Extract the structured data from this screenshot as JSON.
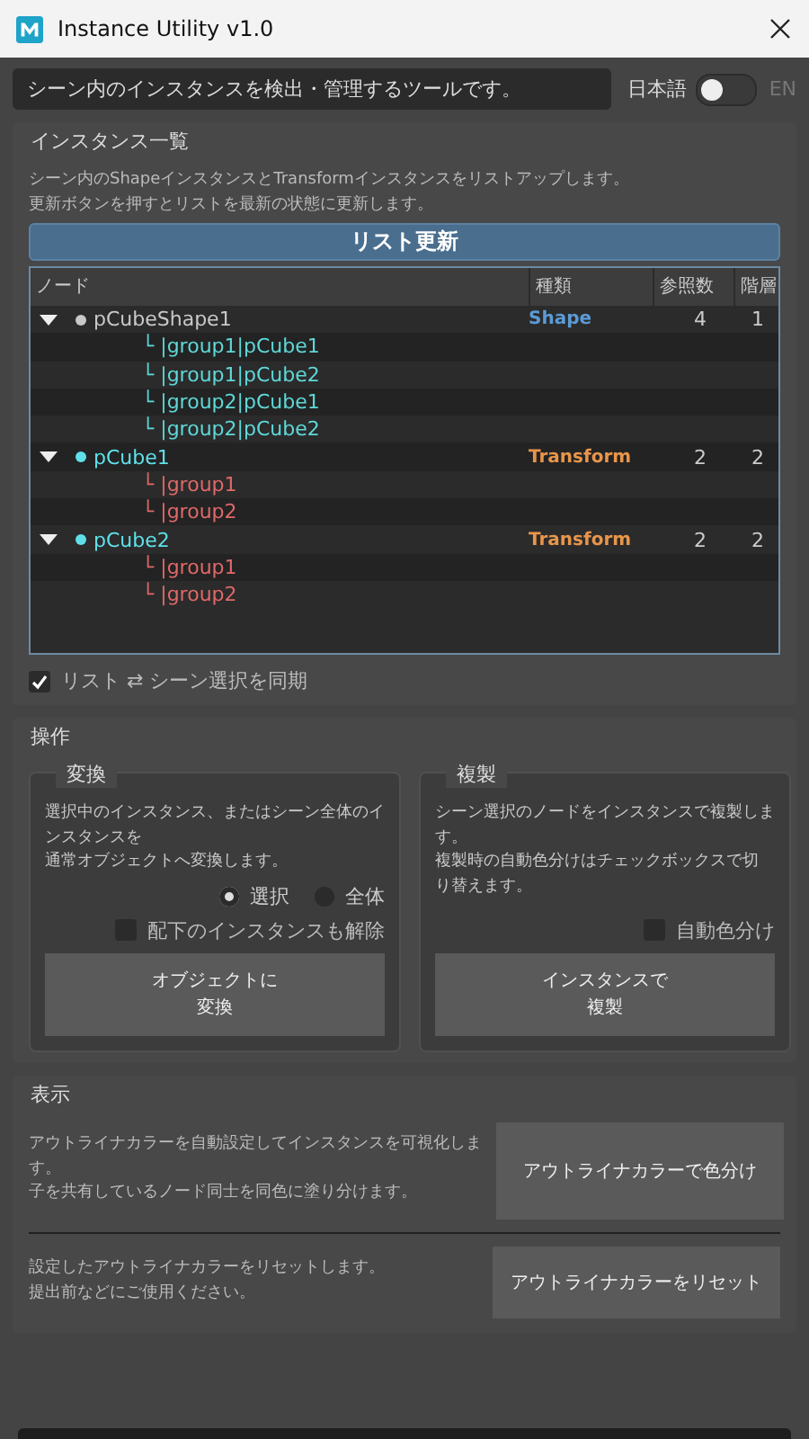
{
  "window": {
    "title": "Instance Utility v1.0"
  },
  "header": {
    "description": "シーン内のインスタンスを検出・管理するツールです。",
    "language": {
      "left": "日本語",
      "right": "EN",
      "on": false
    }
  },
  "instances": {
    "title": "インスタンス一覧",
    "description": [
      "シーン内のShapeインスタンスとTransformインスタンスをリストアップします。",
      "更新ボタンを押すとリストを最新の状態に更新します。"
    ],
    "refresh_button": "リスト更新",
    "table": {
      "columns": [
        "ノード",
        "種類",
        "参照数",
        "階層"
      ],
      "rows": [
        {
          "name": "pCubeShape1",
          "expanded": true,
          "color": "#c8c8c8",
          "type": "Shape",
          "kind": "shape",
          "count": "4",
          "level_text": "1",
          "children": [
            {
              "path": "└ |group1|pCube1",
              "color": "#5fd8d8"
            },
            {
              "path": "└ |group1|pCube2",
              "color": "#5fd8d8"
            },
            {
              "path": "└ |group2|pCube1",
              "color": "#5fd8d8"
            },
            {
              "path": "└ |group2|pCube2",
              "color": "#5fd8d8"
            }
          ]
        },
        {
          "name": "pCube1",
          "expanded": true,
          "color": "#5fe0e8",
          "type": "Transform",
          "kind": "transform",
          "count": "2",
          "level_text": "2",
          "children": [
            {
              "path": "└ |group1",
              "color": "#e06868"
            },
            {
              "path": "└ |group2",
              "color": "#e06868"
            }
          ]
        },
        {
          "name": "pCube2",
          "expanded": true,
          "color": "#5fe0e8",
          "type": "Transform",
          "kind": "transform",
          "count": "2",
          "level_text": "2",
          "children": [
            {
              "path": "└ |group1",
              "color": "#e06868"
            },
            {
              "path": "└ |group2",
              "color": "#e06868"
            }
          ]
        }
      ]
    },
    "sync": {
      "label": "リスト ⇄ シーン選択を同期",
      "checked": true
    }
  },
  "operations": {
    "title": "操作",
    "convert": {
      "title": "変換",
      "description": [
        "選択中のインスタンス、またはシーン全体のイ",
        "ンスタンスを",
        "通常オブジェクトへ変換します。"
      ],
      "radios": [
        {
          "label": "選択",
          "selected": true
        },
        {
          "label": "全体",
          "selected": false
        }
      ],
      "checkbox": {
        "label": "配下のインスタンスも解除",
        "checked": false
      },
      "button": [
        "オブジェクトに",
        "変換"
      ]
    },
    "duplicate": {
      "title": "複製",
      "description": [
        "シーン選択のノードをインスタンスで複製しま",
        "す。",
        "複製時の自動色分けはチェックボックスで切",
        "り替えます。"
      ],
      "checkbox": {
        "label": "自動色分け",
        "checked": false
      },
      "button": [
        "インスタンスで",
        "複製"
      ]
    }
  },
  "display": {
    "title": "表示",
    "items": [
      {
        "description": [
          "アウトライナカラーを自動設定してインスタンスを可視化しま",
          "す。",
          "子を共有しているノード同士を同色に塗り分けます。"
        ],
        "button": "アウトライナカラーで色分け"
      },
      {
        "description": [
          "設定したアウトライナカラーをリセットします。",
          "提出前などにご使用ください。"
        ],
        "button": "アウトライナカラーをリセット"
      }
    ]
  }
}
